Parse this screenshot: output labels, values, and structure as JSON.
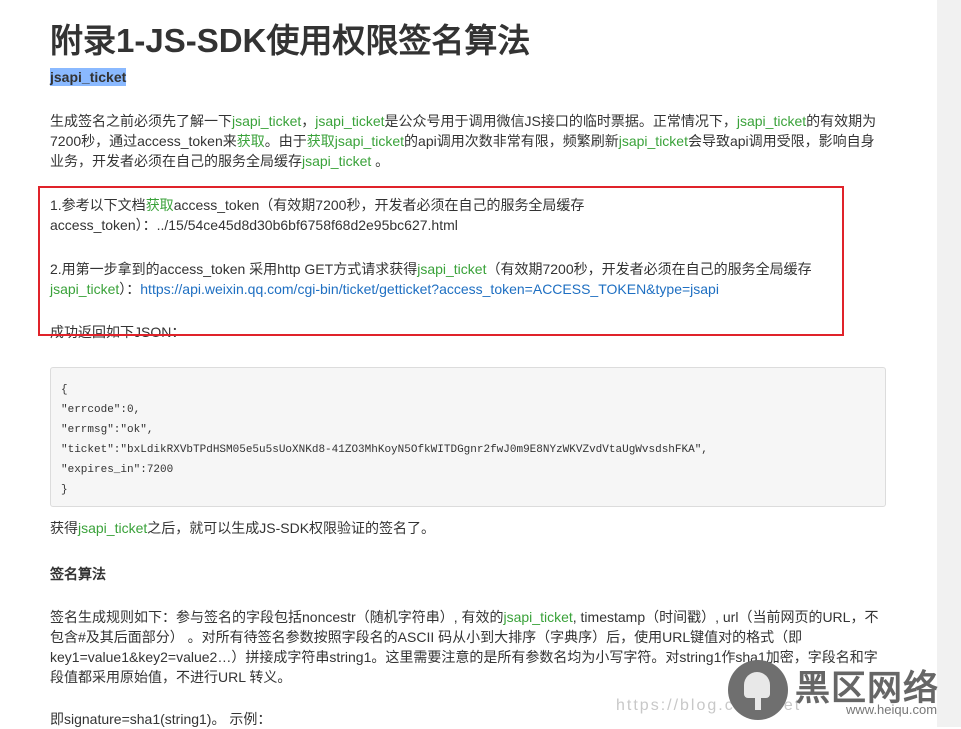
{
  "page_title": "附录1-JS-SDK使用权限签名算法",
  "anchor_label": "jsapi_ticket",
  "intro": {
    "t1": "生成签名之前必须先了解一下",
    "l1": "jsapi_ticket",
    "t2": "，",
    "l2": "jsapi_ticket",
    "t3": "是公众号用于调用微信JS接口的临时票据。正常情况下，",
    "l3": "jsapi_ticket",
    "t4": "的有效期为7200秒，通过access_token来",
    "l4": "获取",
    "t5": "。由于",
    "l5": "获取jsapi_ticket",
    "t6": "的api调用次数非常有限，频繁刷新",
    "l6": "jsapi_ticket",
    "t7": "会导致api调用受限，影响自身业务，开发者必须在自己的服务全局缓存",
    "l7": "jsapi_ticket",
    "t8": " 。"
  },
  "step1": {
    "t1": "1.参考以下文档",
    "l1": "获取",
    "t2": "access_token（有效期7200秒，开发者必须在自己的服务全局缓存access_token）：../15/54ce45d8d30b6bf6758f68d2e95bc627.html"
  },
  "step2": {
    "t1": "2.用第一步拿到的access_token 采用http GET方式请求获得",
    "l1": "jsapi_ticket",
    "t2": "（有效期7200秒，开发者必须在自己的服务全局缓存",
    "l2": "jsapi_ticket",
    "t3": "）：",
    "url": "https://api.weixin.qq.com/cgi-bin/ticket/getticket?access_token=ACCESS_TOKEN&type=jsapi"
  },
  "json_intro": "成功返回如下JSON：",
  "code_lines": [
    "{",
    "\"errcode\":0,",
    "\"errmsg\":\"ok\",",
    "\"ticket\":\"bxLdikRXVbTPdHSM05e5u5sUoXNKd8-41ZO3MhKoyN5OfkWITDGgnr2fwJ0m9E8NYzWKVZvdVtaUgWvsdshFKA\",",
    "\"expires_in\":7200",
    "}"
  ],
  "after_code": {
    "t1": "获得",
    "l1": "jsapi_ticket",
    "t2": "之后，就可以生成JS-SDK权限验证的签名了。"
  },
  "algo_title": "签名算法",
  "rules": {
    "t1": "签名生成规则如下：参与签名的字段包括noncestr（随机字符串）, 有效的",
    "l1": "jsapi_ticket",
    "t2": ", timestamp（时间戳）, url（当前网页的URL，不包含#及其后面部分） 。对所有待签名参数按照字段名的ASCII 码从小到大排序（字典序）后，使用URL键值对的格式（即key1=value1&key2=value2…）拼接成字符串string1。这里需要注意的是所有参数名均为小写字符。对string1作sha1加密，字段名和字段值都采用原始值，不进行URL 转义。"
  },
  "sig_line": "即signature=sha1(string1)。 示例：",
  "watermark": {
    "url_text": "https://blog.csdn.net",
    "brand": "黑区网络",
    "domain": "www.heiqu.com"
  },
  "colors": {
    "link_green": "#3aa23a",
    "link_blue": "#1e6fc2",
    "highlight_box": "#e0232a",
    "anchor_highlight": "#8ab9ff"
  }
}
